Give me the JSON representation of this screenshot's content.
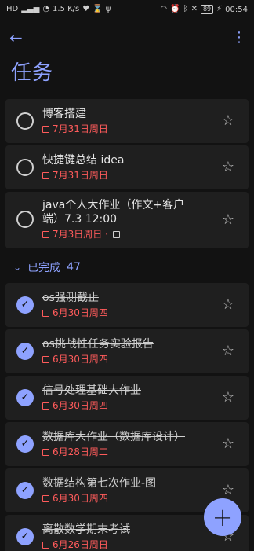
{
  "status": {
    "left_icons": [
      "hd-icon",
      "signal-icon",
      "wifi-icon",
      "speed-text",
      "heart-icon",
      "hourglass-icon",
      "usb-icon"
    ],
    "speed": "1.5\nK/s",
    "right_icons": [
      "headset-icon",
      "alarm-icon",
      "bluetooth-icon",
      "mute-icon",
      "battery-icon"
    ],
    "battery": "89",
    "time": "00:54"
  },
  "app": {
    "title": "任务",
    "colors": {
      "accent": "#8ea2ff",
      "background": "#121212",
      "card": "#1f1f1f",
      "due_red": "#ff5b5b"
    }
  },
  "tasks_active": [
    {
      "title": "博客搭建",
      "due": "7月31日周日"
    },
    {
      "title": "快捷键总结 idea",
      "due": "7月31日周日"
    },
    {
      "title": "java个人大作业（作文+客户端）7.3 12:00",
      "due": "7月3日周日 · "
    }
  ],
  "completed_section": {
    "label": "已完成",
    "count": "47"
  },
  "tasks_done": [
    {
      "title": "os强测截止",
      "due": "6月30日周四"
    },
    {
      "title": "os挑战性任务实验报告",
      "due": "6月30日周四"
    },
    {
      "title": "信号处理基础大作业",
      "due": "6月30日周四"
    },
    {
      "title": "数据库大作业（数据库设计）",
      "due": "6月28日周二"
    },
    {
      "title": "数据结构第七次作业-图",
      "due": "6月30日周四"
    },
    {
      "title": "离散数学期末考试",
      "due": "6月26日周日"
    }
  ],
  "fab": {
    "label": "+"
  }
}
